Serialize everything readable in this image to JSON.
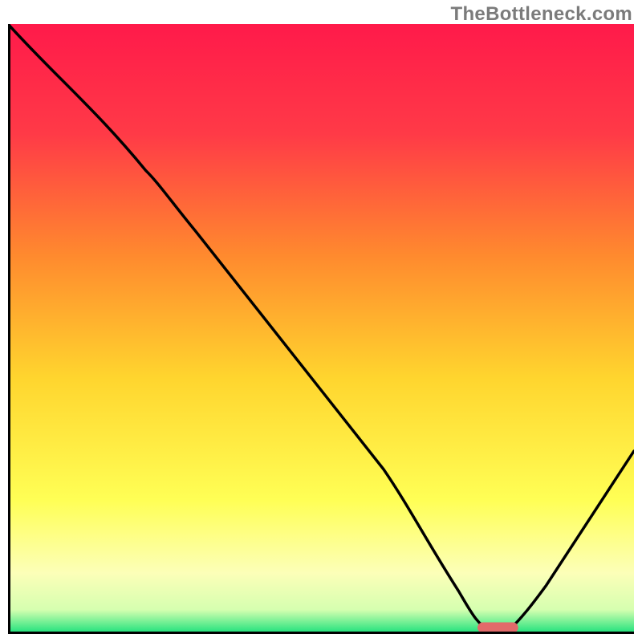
{
  "watermark": "TheBottleneck.com",
  "colors": {
    "gradient_top": "#ff1a4a",
    "gradient_mid1": "#ff7a2e",
    "gradient_mid2": "#ffe23a",
    "gradient_pale": "#feffc8",
    "gradient_green": "#17e07a",
    "curve": "#000000",
    "marker": "#e26a6a",
    "axis": "#000000"
  },
  "chart_data": {
    "type": "line",
    "title": "",
    "xlabel": "",
    "ylabel": "",
    "xlim": [
      0,
      100
    ],
    "ylim": [
      0,
      100
    ],
    "series": [
      {
        "name": "bottleneck-curve",
        "x": [
          0,
          15,
          22,
          30,
          40,
          50,
          60,
          68,
          72,
          75,
          78,
          80,
          85,
          90,
          95,
          100
        ],
        "y": [
          100,
          85,
          76,
          66,
          53,
          40,
          27,
          15,
          7,
          2,
          0,
          0,
          6,
          13,
          21,
          30
        ]
      }
    ],
    "marker": {
      "x_start": 75,
      "x_end": 81,
      "y": 0.8
    },
    "annotations": []
  }
}
